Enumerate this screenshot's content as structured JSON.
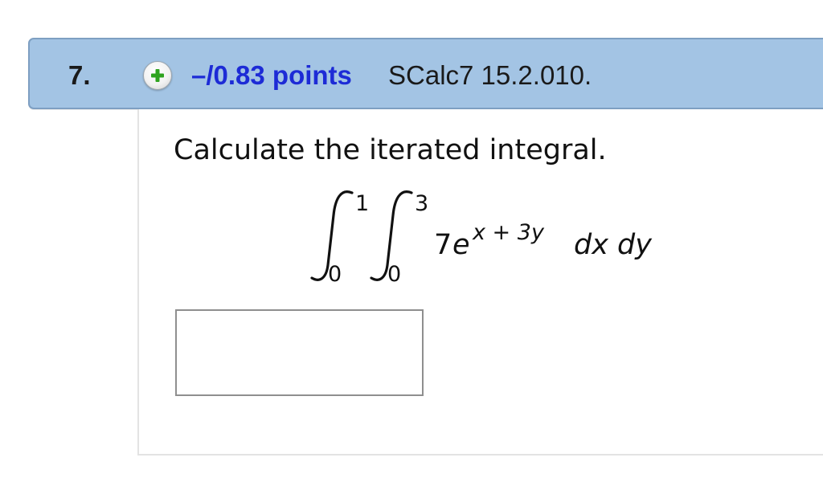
{
  "question": {
    "number": "7.",
    "points_label": "–/0.83 points",
    "source": "SCalc7 15.2.010.",
    "expand_icon": "plus-circle-icon",
    "prompt": "Calculate the iterated integral.",
    "integral": {
      "outer_lower": "0",
      "outer_upper": "1",
      "inner_lower": "0",
      "inner_upper": "3",
      "coefficient": "7",
      "base": "e",
      "exponent": "x + 3y",
      "differentials": "dx dy"
    },
    "answer_value": ""
  },
  "colors": {
    "header_background": "#a3c4e4",
    "header_border": "#7e9fc2",
    "points_text": "#1d2bd6",
    "plus_icon": "#2ea31f"
  }
}
